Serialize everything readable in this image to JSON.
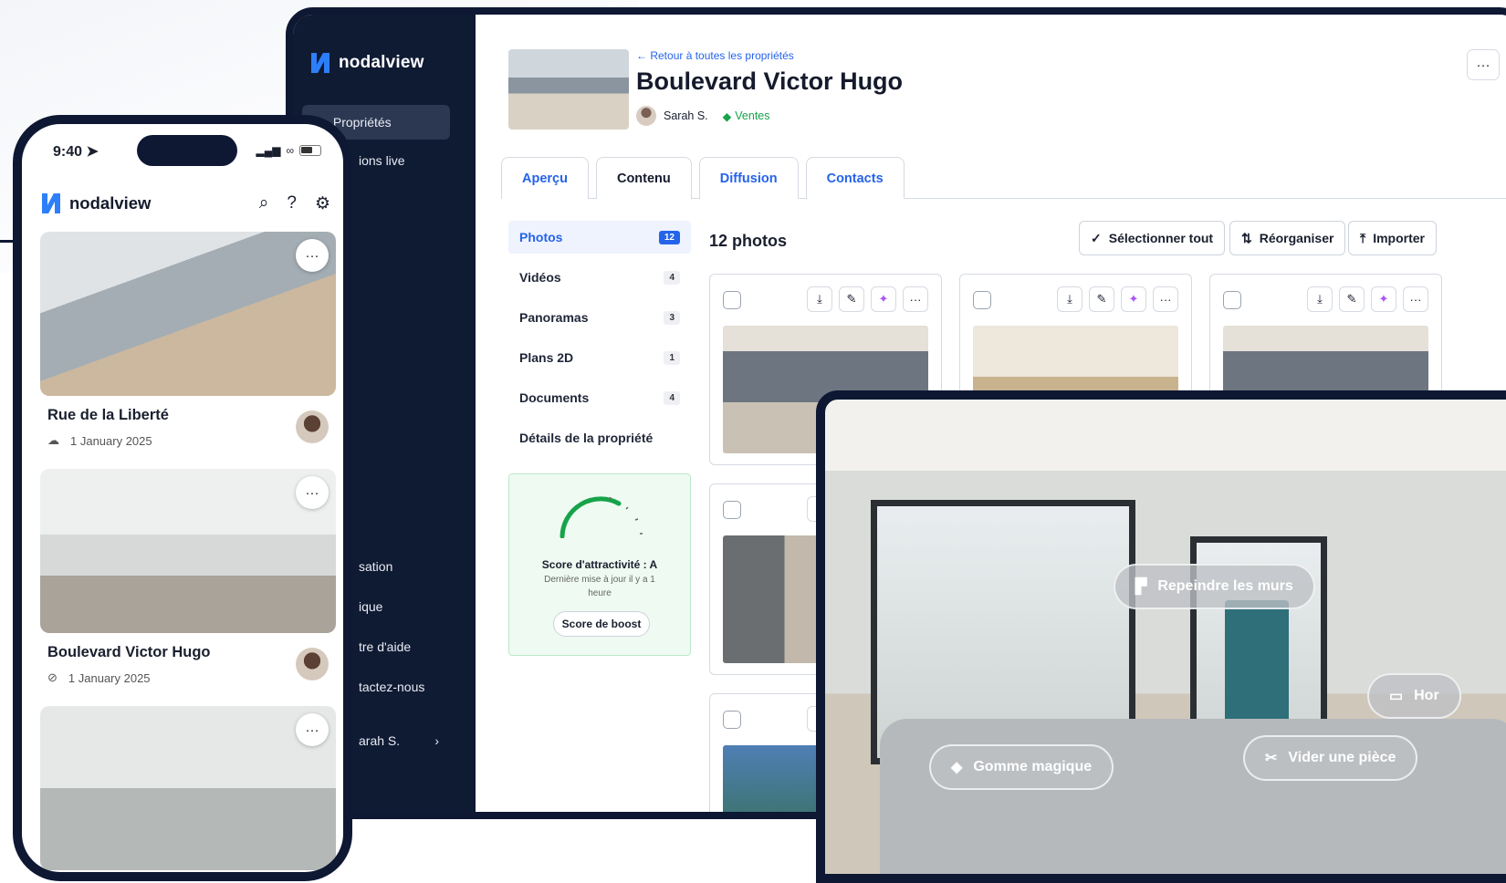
{
  "desktop": {
    "brand": "nodalview",
    "sidebar": [
      {
        "label": "Propriétés",
        "active": true
      },
      {
        "label": "ions live"
      },
      {
        "label": "sation"
      },
      {
        "label": "ique"
      },
      {
        "label": "tre d'aide"
      },
      {
        "label": "tactez-nous"
      },
      {
        "label": "arah S."
      }
    ],
    "back_link": "Retour à toutes les propriétés",
    "title": "Boulevard Victor Hugo",
    "agent": "Sarah S.",
    "tag": "Ventes",
    "more": "···",
    "tabs": [
      "Aperçu",
      "Contenu",
      "Diffusion",
      "Contacts"
    ],
    "categories": [
      {
        "label": "Photos",
        "count": "12"
      },
      {
        "label": "Vidéos",
        "count": "4"
      },
      {
        "label": "Panoramas",
        "count": "3"
      },
      {
        "label": "Plans 2D",
        "count": "1"
      },
      {
        "label": "Documents",
        "count": "4"
      },
      {
        "label": "Détails de la propriété",
        "count": ""
      }
    ],
    "score": {
      "title": "Score d'attractivité : A",
      "subtitle": "Dernière mise à jour il y a 1 heure",
      "button": "Score de boost"
    },
    "photo_count": "12 photos",
    "toolbar": {
      "select_all": "Sélectionner tout",
      "reorder": "Réorganiser",
      "import": "Importer"
    }
  },
  "tablet": {
    "chips": [
      "Repeindre les murs",
      "Hor",
      "Gomme magique",
      "Vider une pièce"
    ]
  },
  "phone": {
    "time": "9:40",
    "brand": "nodalview",
    "listings": [
      {
        "name": "Rue de la Liberté",
        "date": "1 January 2025"
      },
      {
        "name": "Boulevard Victor Hugo",
        "date": "1 January 2025"
      }
    ]
  },
  "colors": {
    "navy": "#0e1833",
    "accent": "#2563eb",
    "green": "#16a34a"
  }
}
